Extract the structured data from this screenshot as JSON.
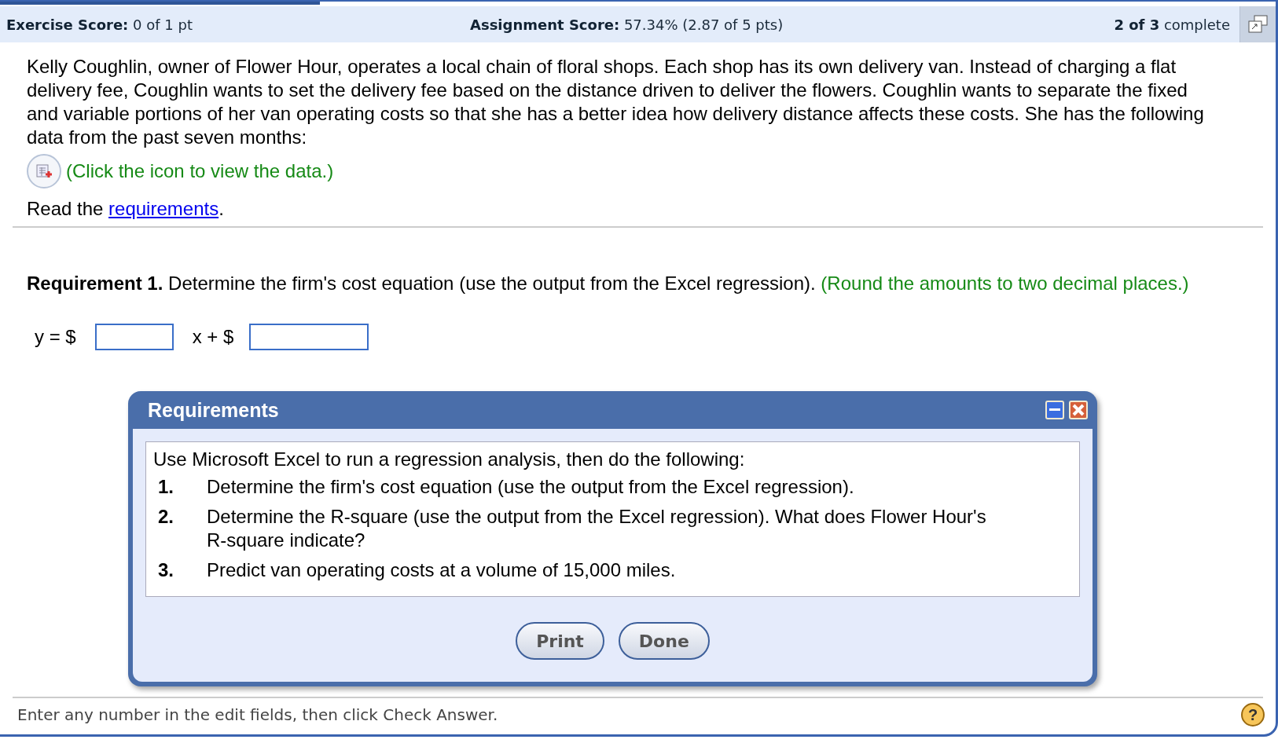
{
  "header": {
    "exercise_score": {
      "label": "Exercise Score:",
      "value": "0 of 1 pt"
    },
    "assignment_score": {
      "label": "Assignment Score:",
      "value": "57.34% (2.87 of 5 pts)"
    },
    "progress": {
      "count": "2 of 3",
      "label": "complete"
    }
  },
  "question": {
    "paragraph": "Kelly Coughlin, owner of Flower Hour, operates a local chain of floral shops. Each shop has its own delivery van. Instead of charging a flat delivery fee, Coughlin wants to set the delivery fee based on the distance driven to deliver the flowers. Coughlin wants to separate the fixed and variable portions of her van operating costs so that she has a better idea how delivery distance affects these costs. She has the following data from the past seven months:",
    "data_link": "(Click the icon to view the data.)",
    "read": {
      "prefix": "Read the",
      "link": "requirements",
      "suffix": "."
    }
  },
  "requirement": {
    "label": "Requirement 1.",
    "text": "Determine the firm's cost equation (use the output from the Excel regression).",
    "note": "(Round the amounts to two decimal places.)"
  },
  "equation": {
    "prefix": "y = $",
    "middle": "x + $"
  },
  "dialog": {
    "title": "Requirements",
    "intro": "Use Microsoft Excel to run a regression analysis, then do the following:",
    "items": [
      {
        "number": "1.",
        "text": "Determine the firm's cost equation (use the output from the Excel regression)."
      },
      {
        "number": "2.",
        "text": "Determine the R-square (use the output from the Excel regression). What does Flower Hour's R-square indicate?"
      },
      {
        "number": "3.",
        "text": "Predict van operating costs at a volume of 15,000 miles."
      }
    ],
    "buttons": [
      "Print",
      "Done"
    ]
  },
  "footer": {
    "hint": "Enter any number in the edit fields, then click Check Answer.",
    "help": "?"
  }
}
